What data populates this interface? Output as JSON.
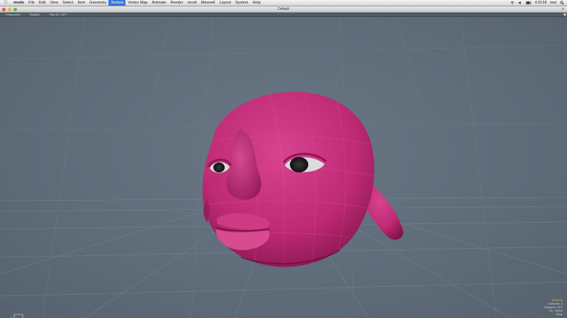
{
  "menubar": {
    "app_name": "modo",
    "items": [
      "File",
      "Edit",
      "View",
      "Select",
      "Item",
      "Geometry",
      "Texture",
      "Vertex Map",
      "Animate",
      "Render",
      "recoll",
      "Maxwell",
      "Layout",
      "System",
      "Help"
    ],
    "active_item": "Texture",
    "clock": "4:22:58",
    "user": "iwai"
  },
  "window": {
    "title": "Default"
  },
  "viewport_toolbar": {
    "view_mode": "Perspective",
    "shading": "Shaded",
    "ray_gl": "Ray GL: OFF"
  },
  "info_panel": {
    "selection": "All Items",
    "lines": [
      "Channels: 0",
      "Polygons: OFF",
      "GL: 16000",
      "Show"
    ]
  },
  "colors": {
    "mesh": "#c42d79",
    "background": "#5f6c79",
    "accent": "#f3b43a"
  }
}
